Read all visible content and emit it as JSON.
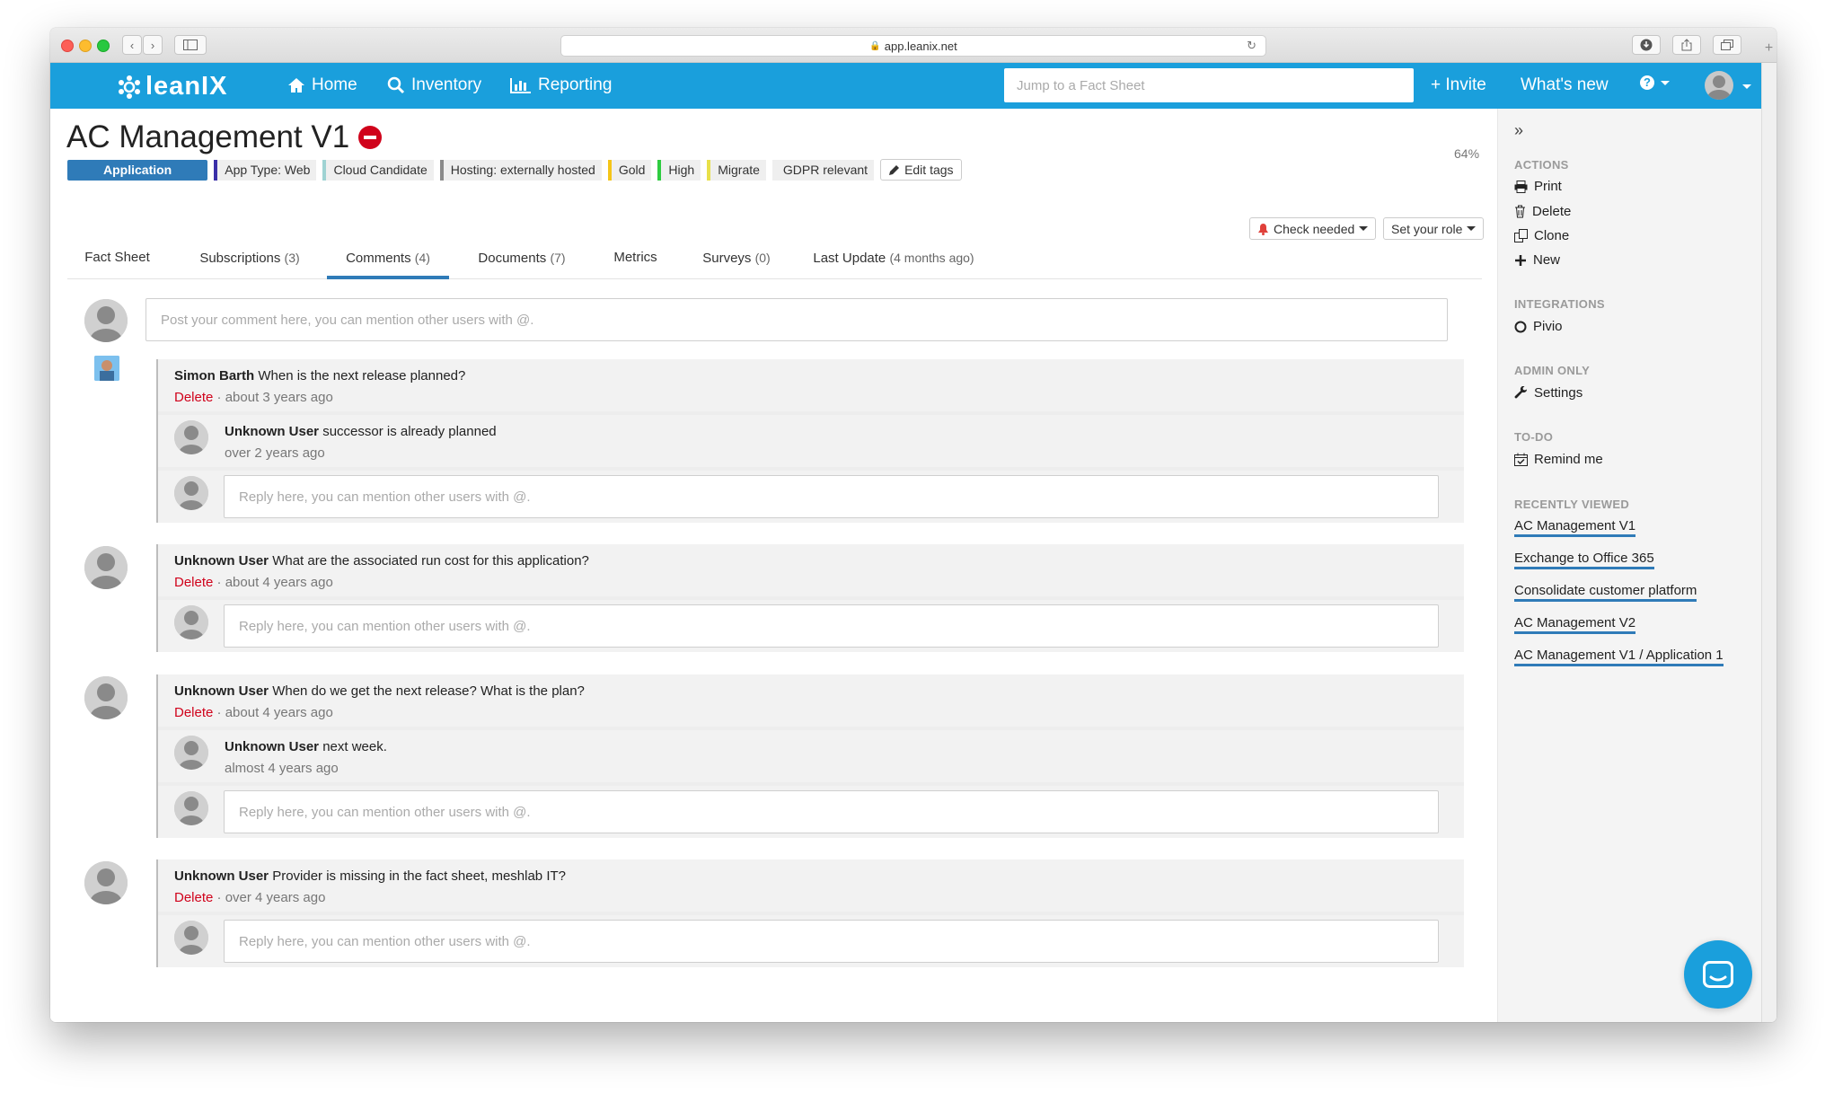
{
  "browser": {
    "url": "app.leanix.net"
  },
  "topnav": {
    "logo": "leanIX",
    "home": "Home",
    "inventory": "Inventory",
    "reporting": "Reporting",
    "search_placeholder": "Jump to a Fact Sheet",
    "invite": "+ Invite",
    "whats_new": "What's new",
    "help": "?"
  },
  "factsheet": {
    "title": "AC Management V1",
    "completion": "64%",
    "type_badge": "Application",
    "tags": [
      {
        "label": "App Type: Web",
        "color": "#3a2fa8"
      },
      {
        "label": "Cloud Candidate",
        "color": "#9fd3d3"
      },
      {
        "label": "Hosting: externally hosted",
        "color": "#8a8a8a"
      },
      {
        "label": "Gold",
        "color": "#f5c518"
      },
      {
        "label": "High",
        "color": "#2ecc40"
      },
      {
        "label": "Migrate",
        "color": "#e8e04a"
      },
      {
        "label": "GDPR relevant",
        "color": "#efefef"
      }
    ],
    "edit_tags": "Edit tags",
    "check_needed": "Check needed",
    "set_role": "Set your role"
  },
  "tabs": [
    {
      "label": "Fact Sheet",
      "sub": ""
    },
    {
      "label": "Subscriptions",
      "sub": "(3)"
    },
    {
      "label": "Comments",
      "sub": "(4)"
    },
    {
      "label": "Documents",
      "sub": "(7)"
    },
    {
      "label": "Metrics",
      "sub": ""
    },
    {
      "label": "Surveys",
      "sub": "(0)"
    },
    {
      "label": "Last Update",
      "sub": "(4 months ago)"
    }
  ],
  "comments": {
    "post_placeholder": "Post your comment here, you can mention other users with @.",
    "reply_placeholder": "Reply here, you can mention other users with @.",
    "delete_label": "Delete",
    "threads": [
      {
        "author": "Simon Barth",
        "text": "When is the next release planned?",
        "time": "about 3 years ago",
        "reply": {
          "author": "Unknown User",
          "text": "successor is already planned",
          "time": "over 2 years ago"
        }
      },
      {
        "author": "Unknown User",
        "text": "What are the associated run cost for this application?",
        "time": "about 4 years ago"
      },
      {
        "author": "Unknown User",
        "text": "When do we get the next release? What is the plan?",
        "time": "about 4 years ago",
        "reply": {
          "author": "Unknown User",
          "text": "next week.",
          "time": "almost 4 years ago"
        }
      },
      {
        "author": "Unknown User",
        "text": "Provider is missing in the fact sheet, meshlab IT?",
        "time": "over 4 years ago"
      }
    ]
  },
  "sidebar": {
    "actions_head": "ACTIONS",
    "print": "Print",
    "delete": "Delete",
    "clone": "Clone",
    "new": "New",
    "integrations_head": "INTEGRATIONS",
    "pivio": "Pivio",
    "admin_head": "ADMIN ONLY",
    "settings": "Settings",
    "todo_head": "TO-DO",
    "remind": "Remind me",
    "recent_head": "RECENTLY VIEWED",
    "recent": [
      "AC Management V1",
      "Exchange to Office 365",
      "Consolidate customer platform",
      "AC Management V2",
      "AC Management V1 / Application 1"
    ]
  }
}
